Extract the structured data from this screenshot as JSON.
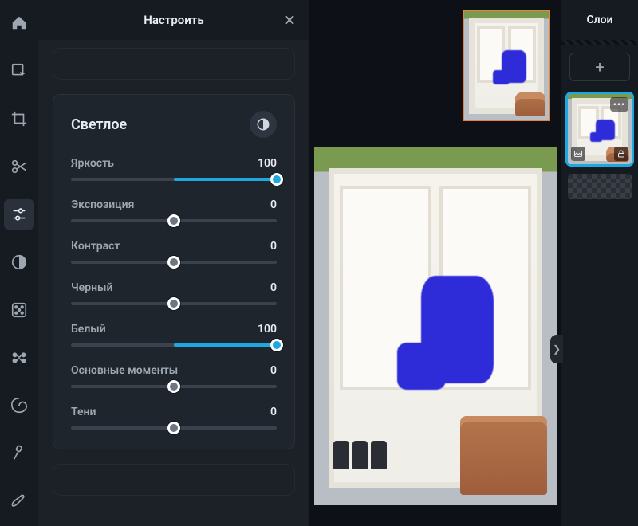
{
  "panel": {
    "title": "Настроить"
  },
  "section": {
    "title": "Светлое",
    "sliders": [
      {
        "label": "Яркость",
        "value": "100",
        "pos": "100",
        "accent": true
      },
      {
        "label": "Экспозиция",
        "value": "0",
        "pos": "50",
        "accent": false
      },
      {
        "label": "Контраст",
        "value": "0",
        "pos": "50",
        "accent": false
      },
      {
        "label": "Черный",
        "value": "0",
        "pos": "50",
        "accent": false
      },
      {
        "label": "Белый",
        "value": "100",
        "pos": "100",
        "accent": true
      },
      {
        "label": "Основные моменты",
        "value": "0",
        "pos": "50",
        "accent": false
      },
      {
        "label": "Тени",
        "value": "0",
        "pos": "50",
        "accent": false
      }
    ]
  },
  "layers": {
    "title": "Слои"
  }
}
